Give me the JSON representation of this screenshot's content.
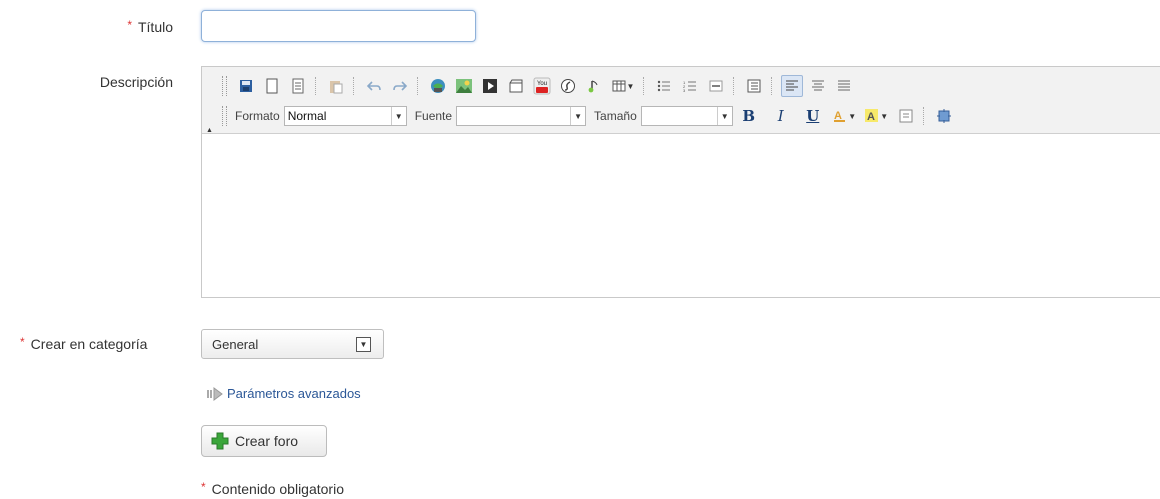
{
  "form": {
    "titulo_label": "Título",
    "titulo_value": "",
    "descripcion_label": "Descripción",
    "categoria_label": "Crear en categoría",
    "categoria_value": "General",
    "advanced_link": "Parámetros avanzados",
    "submit_label": "Crear foro",
    "required_note": "Contenido obligatorio",
    "required_marker": "*"
  },
  "editor": {
    "format_label": "Formato",
    "format_value": "Normal",
    "font_label": "Fuente",
    "font_value": "",
    "size_label": "Tamaño",
    "size_value": "",
    "bold": "B",
    "italic": "I",
    "underline": "U",
    "youtube_text": "You",
    "body_text": ""
  },
  "colors": {
    "accent": "#2b5797",
    "required": "#dd3333",
    "focus_border": "#8fb1d9",
    "add_icon": "#3aa63a"
  }
}
